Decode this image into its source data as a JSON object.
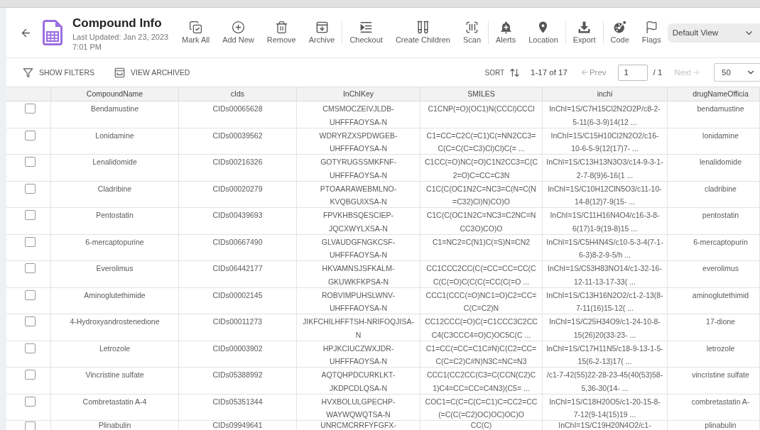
{
  "header": {
    "title": "Compound Info",
    "last_updated": "Last Updated: Jan 23, 2023 7:01 PM"
  },
  "toolbar": {
    "groups": [
      [
        {
          "kind": "mark",
          "label": "Mark All"
        },
        {
          "kind": "add",
          "label": "Add New"
        },
        {
          "kind": "remove",
          "label": "Remove"
        },
        {
          "kind": "archive",
          "label": "Archive"
        }
      ],
      [
        {
          "kind": "checkout",
          "label": "Checkout"
        },
        {
          "kind": "children",
          "label": "Create Children"
        },
        {
          "kind": "scan",
          "label": "Scan"
        }
      ],
      [
        {
          "kind": "alerts",
          "label": "Alerts"
        },
        {
          "kind": "location",
          "label": "Location"
        }
      ],
      [
        {
          "kind": "export",
          "label": "Export"
        }
      ],
      [
        {
          "kind": "code",
          "label": "Code"
        },
        {
          "kind": "flags",
          "label": "Flags"
        }
      ]
    ],
    "view_select": {
      "value": "Default View"
    }
  },
  "list_bar": {
    "show_filters": "SHOW FILTERS",
    "view_archived": "VIEW ARCHIVED",
    "sort": "SORT",
    "range": "1-17 of 17",
    "prev": {
      "label": "Prev",
      "disabled": false
    },
    "page": "1",
    "page_total": "/ 1",
    "next": {
      "label": "Next",
      "disabled": true
    },
    "per_page": "50"
  },
  "table": {
    "columns": [
      "CompoundName",
      "cIds",
      "InChIKey",
      "SMILES",
      "inchi",
      "drugNameOfficia"
    ],
    "rows": [
      {
        "checked": false,
        "cells": [
          "Bendamustine",
          "CIDs00065628",
          "CMSMOCZEIVJLDB-UHFFFAOYSA-N",
          "C1CNP(=O)(OC1)N(CCCl)CCCl",
          "InChI=1S/C7H15Cl2N2O2P/c8-2-5-11(6-3-9)14(12 ...",
          "bendamustine"
        ]
      },
      {
        "checked": false,
        "cells": [
          "Lonidamine",
          "CIDs00039562",
          "WDRYRZXSPDWGEB-UHFFFAOYSA-N",
          "C1=CC=C2C(=C1)C(=NN2CC3=C(C=C(C=C3)Cl)Cl)C(= ...",
          "InChI=1S/C15H10Cl2N2O2/c16-10-6-5-9(12(17)7- ...",
          "lonidamine"
        ]
      },
      {
        "checked": false,
        "cells": [
          "Lenalidomide",
          "CIDs00216326",
          "GOTYRUGSSMKFNF-UHFFFAOYSA-N",
          "C1CC(=O)NC(=O)C1N2CC3=C(C2=O)C=CC=C3N",
          "InChI=1S/C13H13N3O3/c14-9-3-1-2-7-8(9)6-16(1 ...",
          "lenalidomide"
        ]
      },
      {
        "checked": false,
        "cells": [
          "Cladribine",
          "CIDs00020279",
          "PTOAARAWEBMLNO-KVQBGUIXSA-N",
          "C1C(C(OC1N2C=NC3=C(N=C(N=C32)Cl)N)CO)O",
          "InChI=1S/C10H12ClN5O3/c11-10-14-8(12)7-9(15- ...",
          "cladribine"
        ]
      },
      {
        "checked": false,
        "cells": [
          "Pentostatin",
          "CIDs00439693",
          "FPVKHBSQESCIEP-JQCXWYLXSA-N",
          "C1C(C(OC1N2C=NC3=C2NC=NCC3O)CO)O",
          "InChI=1S/C11H16N4O4/c16-3-8-6(17)1-9(19-8)15 ...",
          "pentostatin"
        ]
      },
      {
        "checked": false,
        "cells": [
          "6-mercaptopurine",
          "CIDs00667490",
          "GLVAUDGFNGKCSF-UHFFFAOYSA-N",
          "C1=NC2=C(N1)C(=S)N=CN2",
          "InChI=1S/C5H4N4S/c10-5-3-4(7-1-6-3)8-2-9-5/h ...",
          "6-mercaptopurin"
        ]
      },
      {
        "checked": false,
        "cells": [
          "Everolimus",
          "CIDs06442177",
          "HKVAMNSJSFKALM-GKUWKFKPSA-N",
          "CC1CCC2CC(C(=CC=CC=CC(CC(C(=O)C(C(C(=CC(C(=O ...",
          "InChI=1S/C53H83NO14/c1-32-16-12-11-13-17-33( ...",
          "everolimus"
        ]
      },
      {
        "checked": false,
        "cells": [
          "Aminoglutethimide",
          "CIDs00002145",
          "ROBVIMPUHSLWNV-UHFFFAOYSA-N",
          "CCC1(CCC(=O)NC1=O)C2=CC=C(C=C2)N",
          "InChI=1S/C13H16N2O2/c1-2-13(8-7-11(16)15-12( ...",
          "aminoglutethimid"
        ]
      },
      {
        "checked": false,
        "cells": [
          "4-Hydroxyandrostenedione",
          "CIDs00011273",
          "JIKFCHILHFFTSH-NRIFOQJISA-N",
          "CC12CCC(=O)C(=C1CCC3C2CCC4(C3CCC4=O)C)OC5C(C ...",
          "InChI=1S/C25H34O9/c1-24-10-8-15(26)20(33-23- ...",
          "17-dione"
        ]
      },
      {
        "checked": false,
        "cells": [
          "Letrozole",
          "CIDs00003902",
          "HPJKCIUCZWXJDR-UHFFFAOYSA-N",
          "C1=CC(=CC=C1C#N)C(C2=CC=C(C=C2)C#N)N3C=NC=N3",
          "InChI=1S/C17H11N5/c18-9-13-1-5-15(6-2-13)17( ...",
          "letrozole"
        ]
      },
      {
        "checked": false,
        "cells": [
          "Vincristine sulfate",
          "CIDs05388992",
          "AQTQHPDCURKLKT-JKDPCDLQSA-N",
          "CCC1(CC2CC(C3=C(CCN(C2)C1)C4=CC=CC=C4N3)(C5= ...",
          "/c1-7-42(55)22-28-23-45(40(53)58-5,36-30(14- ...",
          "vincristine sulfate"
        ]
      },
      {
        "checked": false,
        "cells": [
          "Combretastatin A-4",
          "CIDs05351344",
          "HVXBOLULGPECHP-WAYWQWQTSA-N",
          "COC1=C(C=C(C=C1)C=CC2=CC(=C(C(=C2)OC)OC)OC)O",
          "InChI=1S/C18H20O5/c1-20-15-8-7-12(9-14(15)19 ...",
          "combretastatin A-"
        ]
      },
      {
        "checked": false,
        "cells": [
          "Plinabulin",
          "CIDs09949641",
          "UNRCMCRRFYFGFX-",
          "CC(C)",
          "InChI=1S/C19H20N4O2/c1-",
          "plinabulin"
        ]
      }
    ]
  }
}
